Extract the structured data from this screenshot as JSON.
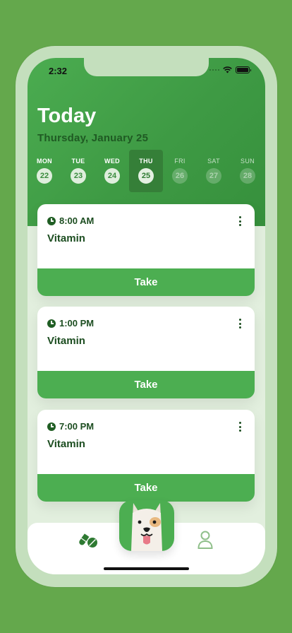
{
  "status_bar": {
    "time": "2:32"
  },
  "header": {
    "title": "Today",
    "date": "Thursday, January 25"
  },
  "week": [
    {
      "label": "MON",
      "date": "22",
      "state": "normal"
    },
    {
      "label": "TUE",
      "date": "23",
      "state": "normal"
    },
    {
      "label": "WED",
      "date": "24",
      "state": "normal"
    },
    {
      "label": "THU",
      "date": "25",
      "state": "selected"
    },
    {
      "label": "FRI",
      "date": "26",
      "state": "faded"
    },
    {
      "label": "SAT",
      "date": "27",
      "state": "faded"
    },
    {
      "label": "SUN",
      "date": "28",
      "state": "faded"
    }
  ],
  "doses": [
    {
      "time": "8:00 AM",
      "name": "Vitamin",
      "action": "Take"
    },
    {
      "time": "1:00 PM",
      "name": "Vitamin",
      "action": "Take"
    },
    {
      "time": "7:00 PM",
      "name": "Vitamin",
      "action": "Take"
    }
  ],
  "tabbar": {
    "left_icon": "pills-icon",
    "center_icon": "dog-mascot-icon",
    "right_icon": "person-icon"
  },
  "colors": {
    "background": "#64a84c",
    "primary": "#4cae51",
    "header_dark": "#357f38",
    "text_dark": "#1c4d20"
  }
}
